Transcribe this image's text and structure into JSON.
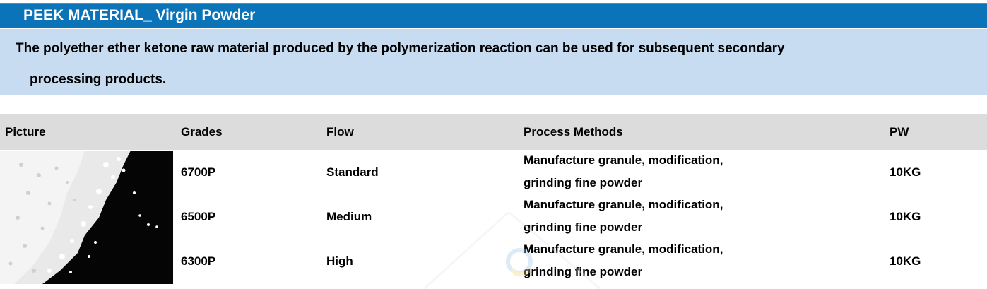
{
  "section": {
    "title": "PEEK MATERIAL_ Virgin Powder",
    "description_line1": "The polyether ether ketone raw material produced by the polymerization reaction can be used for subsequent secondary",
    "description_line2": "processing products."
  },
  "table": {
    "headers": {
      "picture": "Picture",
      "grades": "Grades",
      "flow": "Flow",
      "process": "Process Methods",
      "pw": "PW"
    },
    "rows": [
      {
        "grade": "6700P",
        "flow": "Standard",
        "process_line1": "Manufacture granule, modification,",
        "process_line2": "grinding fine powder",
        "pw": "10KG"
      },
      {
        "grade": "6500P",
        "flow": "Medium",
        "process_line1": "Manufacture granule, modification,",
        "process_line2": "grinding fine powder",
        "pw": "10KG"
      },
      {
        "grade": "6300P",
        "flow": "High",
        "process_line1": "Manufacture granule, modification,",
        "process_line2": "grinding fine powder",
        "pw": "10KG"
      }
    ]
  },
  "colors": {
    "header_bar": "#0b73b8",
    "description_background": "#c8dcf1",
    "table_header_background": "#dcdcdc"
  }
}
